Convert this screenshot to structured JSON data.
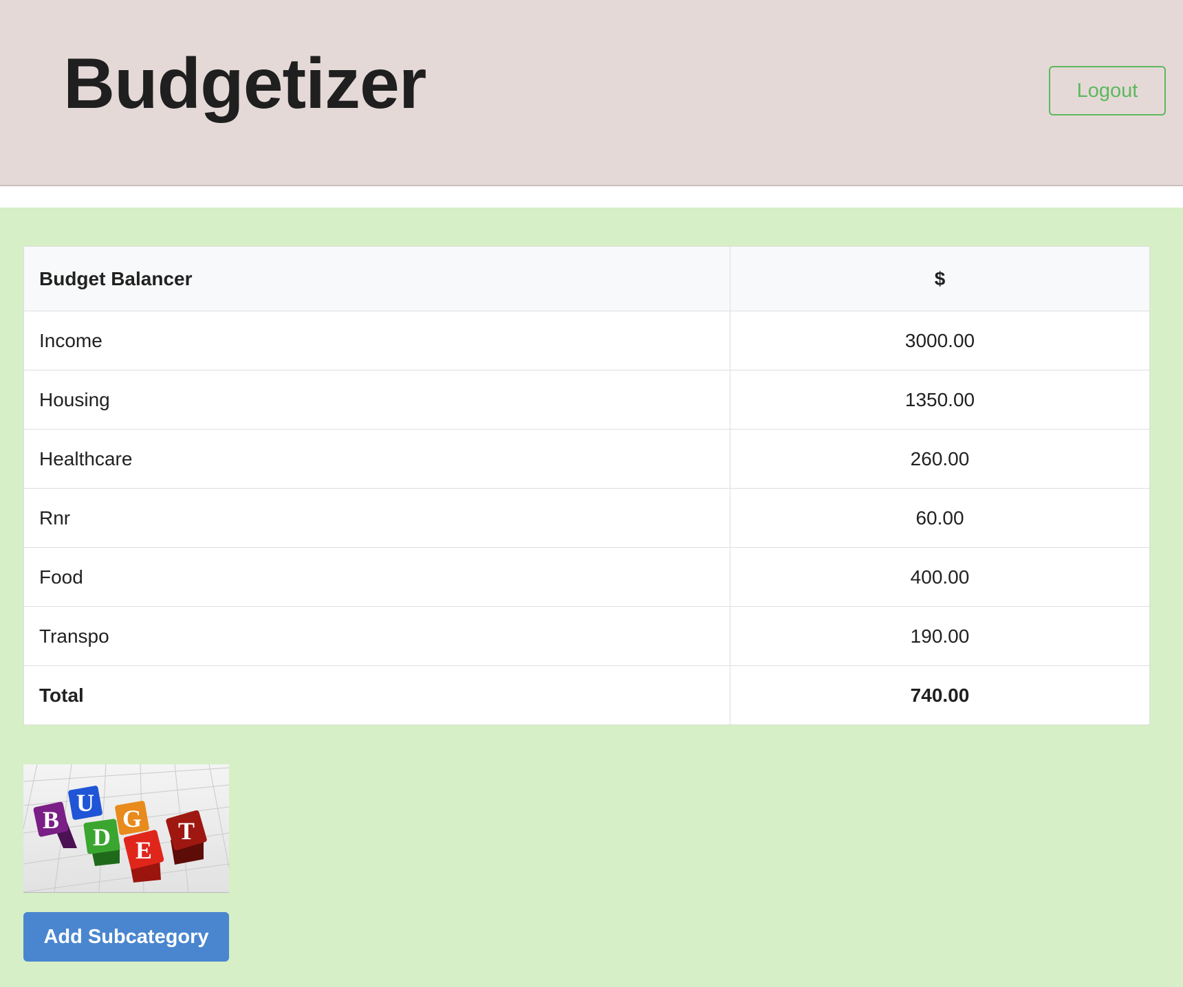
{
  "header": {
    "title": "Budgetizer",
    "logout_label": "Logout"
  },
  "table": {
    "headers": [
      "Budget Balancer",
      "$"
    ],
    "rows": [
      {
        "category": "Income",
        "amount": "3000.00"
      },
      {
        "category": "Housing",
        "amount": "1350.00"
      },
      {
        "category": "Healthcare",
        "amount": "260.00"
      },
      {
        "category": "Rnr",
        "amount": "60.00"
      },
      {
        "category": "Food",
        "amount": "400.00"
      },
      {
        "category": "Transpo",
        "amount": "190.00"
      }
    ],
    "total": {
      "label": "Total",
      "amount": "740.00"
    }
  },
  "image": {
    "letters": [
      "B",
      "U",
      "D",
      "G",
      "E",
      "T"
    ],
    "block_colors": [
      "#7a1f86",
      "#1f55d6",
      "#3aa62f",
      "#e88a1c",
      "#e0261b",
      "#9e1710"
    ]
  },
  "actions": {
    "add_subcategory_label": "Add Subcategory"
  },
  "colors": {
    "header_bg": "#e4d9d7",
    "page_bg": "#d6efc6",
    "logout_accent": "#5cb85c",
    "primary_button": "#4a86cf"
  }
}
